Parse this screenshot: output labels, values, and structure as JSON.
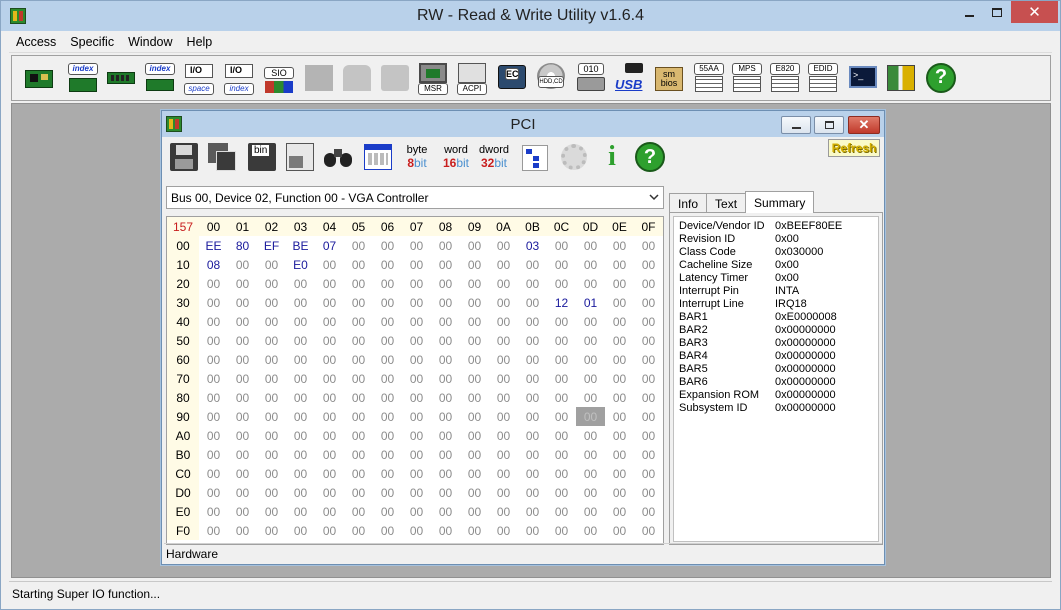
{
  "window": {
    "title": "RW - Read & Write Utility v1.6.4"
  },
  "menu": [
    "Access",
    "Specific",
    "Window",
    "Help"
  ],
  "toolbar": {
    "labels": {
      "index1": "index",
      "index2": "index",
      "space": "space",
      "index3": "index",
      "sio": "SIO",
      "msr": "MSR",
      "acpi": "ACPI",
      "ec": "EC",
      "hdd": "HDD,CD",
      "b010": "010",
      "usb": "USB",
      "smbios": "sm bios",
      "b55aa": "55AA",
      "mps": "MPS",
      "e820": "E820",
      "edid": "EDID"
    }
  },
  "pci": {
    "title": "PCI",
    "buttons": {
      "byte_l1": "byte",
      "byte_n": "8",
      "byte_b": "bit",
      "word_l1": "word",
      "word_n": "16",
      "word_b": "bit",
      "dword_l1": "dword",
      "dword_n": "32",
      "dword_b": "bit"
    },
    "refresh_label": "Refresh",
    "device_select": "Bus 00, Device 02, Function 00 -  VGA Controller",
    "hex": {
      "corner": "157",
      "cols": [
        "00",
        "01",
        "02",
        "03",
        "04",
        "05",
        "06",
        "07",
        "08",
        "09",
        "0A",
        "0B",
        "0C",
        "0D",
        "0E",
        "0F"
      ],
      "rows": [
        {
          "h": "00",
          "c": [
            "EE",
            "80",
            "EF",
            "BE",
            "07",
            "00",
            "00",
            "00",
            "00",
            "00",
            "00",
            "03",
            "00",
            "00",
            "00",
            "00"
          ]
        },
        {
          "h": "10",
          "c": [
            "08",
            "00",
            "00",
            "E0",
            "00",
            "00",
            "00",
            "00",
            "00",
            "00",
            "00",
            "00",
            "00",
            "00",
            "00",
            "00"
          ]
        },
        {
          "h": "20",
          "c": [
            "00",
            "00",
            "00",
            "00",
            "00",
            "00",
            "00",
            "00",
            "00",
            "00",
            "00",
            "00",
            "00",
            "00",
            "00",
            "00"
          ]
        },
        {
          "h": "30",
          "c": [
            "00",
            "00",
            "00",
            "00",
            "00",
            "00",
            "00",
            "00",
            "00",
            "00",
            "00",
            "00",
            "12",
            "01",
            "00",
            "00"
          ]
        },
        {
          "h": "40",
          "c": [
            "00",
            "00",
            "00",
            "00",
            "00",
            "00",
            "00",
            "00",
            "00",
            "00",
            "00",
            "00",
            "00",
            "00",
            "00",
            "00"
          ]
        },
        {
          "h": "50",
          "c": [
            "00",
            "00",
            "00",
            "00",
            "00",
            "00",
            "00",
            "00",
            "00",
            "00",
            "00",
            "00",
            "00",
            "00",
            "00",
            "00"
          ]
        },
        {
          "h": "60",
          "c": [
            "00",
            "00",
            "00",
            "00",
            "00",
            "00",
            "00",
            "00",
            "00",
            "00",
            "00",
            "00",
            "00",
            "00",
            "00",
            "00"
          ]
        },
        {
          "h": "70",
          "c": [
            "00",
            "00",
            "00",
            "00",
            "00",
            "00",
            "00",
            "00",
            "00",
            "00",
            "00",
            "00",
            "00",
            "00",
            "00",
            "00"
          ]
        },
        {
          "h": "80",
          "c": [
            "00",
            "00",
            "00",
            "00",
            "00",
            "00",
            "00",
            "00",
            "00",
            "00",
            "00",
            "00",
            "00",
            "00",
            "00",
            "00"
          ]
        },
        {
          "h": "90",
          "c": [
            "00",
            "00",
            "00",
            "00",
            "00",
            "00",
            "00",
            "00",
            "00",
            "00",
            "00",
            "00",
            "00",
            "00",
            "00",
            "00"
          ]
        },
        {
          "h": "A0",
          "c": [
            "00",
            "00",
            "00",
            "00",
            "00",
            "00",
            "00",
            "00",
            "00",
            "00",
            "00",
            "00",
            "00",
            "00",
            "00",
            "00"
          ]
        },
        {
          "h": "B0",
          "c": [
            "00",
            "00",
            "00",
            "00",
            "00",
            "00",
            "00",
            "00",
            "00",
            "00",
            "00",
            "00",
            "00",
            "00",
            "00",
            "00"
          ]
        },
        {
          "h": "C0",
          "c": [
            "00",
            "00",
            "00",
            "00",
            "00",
            "00",
            "00",
            "00",
            "00",
            "00",
            "00",
            "00",
            "00",
            "00",
            "00",
            "00"
          ]
        },
        {
          "h": "D0",
          "c": [
            "00",
            "00",
            "00",
            "00",
            "00",
            "00",
            "00",
            "00",
            "00",
            "00",
            "00",
            "00",
            "00",
            "00",
            "00",
            "00"
          ]
        },
        {
          "h": "E0",
          "c": [
            "00",
            "00",
            "00",
            "00",
            "00",
            "00",
            "00",
            "00",
            "00",
            "00",
            "00",
            "00",
            "00",
            "00",
            "00",
            "00"
          ]
        },
        {
          "h": "F0",
          "c": [
            "00",
            "00",
            "00",
            "00",
            "00",
            "00",
            "00",
            "00",
            "00",
            "00",
            "00",
            "00",
            "00",
            "00",
            "00",
            "00"
          ]
        }
      ],
      "selected_cell": {
        "row": 9,
        "col": 13
      }
    },
    "tabs": [
      "Info",
      "Text",
      "Summary"
    ],
    "active_tab": "Summary",
    "summary": [
      {
        "k": "Device/Vendor ID",
        "v": "0xBEEF80EE"
      },
      {
        "k": "Revision ID",
        "v": "0x00"
      },
      {
        "k": "Class Code",
        "v": "0x030000"
      },
      {
        "k": "Cacheline Size",
        "v": "0x00"
      },
      {
        "k": "Latency Timer",
        "v": "0x00"
      },
      {
        "k": "Interrupt Pin",
        "v": "INTA"
      },
      {
        "k": "Interrupt Line",
        "v": "IRQ18"
      },
      {
        "k": "BAR1",
        "v": "0xE0000008"
      },
      {
        "k": "BAR2",
        "v": "0x00000000"
      },
      {
        "k": "BAR3",
        "v": "0x00000000"
      },
      {
        "k": "BAR4",
        "v": "0x00000000"
      },
      {
        "k": "BAR5",
        "v": "0x00000000"
      },
      {
        "k": "BAR6",
        "v": "0x00000000"
      },
      {
        "k": "Expansion ROM",
        "v": "0x00000000"
      },
      {
        "k": "Subsystem ID",
        "v": "0x00000000"
      }
    ],
    "hardware_label": "Hardware"
  },
  "status": {
    "text": "Starting Super IO function..."
  }
}
